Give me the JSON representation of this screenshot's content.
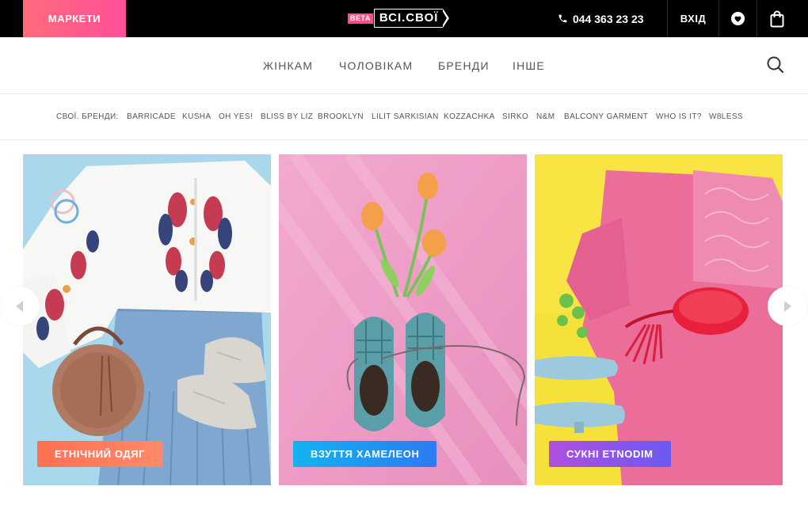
{
  "header": {
    "markets_label": "МАРКЕТИ",
    "logo_beta": "BETA",
    "logo_name": "ВСІ.СВОЇ",
    "phone": "044 363 23 23",
    "login_label": "ВХІД",
    "icons": [
      "phone-icon",
      "heart-icon",
      "shopping-bag-icon"
    ]
  },
  "nav": {
    "items": [
      "ЖІНКАМ",
      "ЧОЛОВІКАМ",
      "БРЕНДИ",
      "ІНШЕ"
    ],
    "search_icon": "search-icon"
  },
  "brands": {
    "label": "СВОЇ. БРЕНДИ:",
    "items": [
      "BARRICADE",
      "KUSHA",
      "OH YES!",
      "BLISS BY LIZ",
      "BROOKLYN",
      "LILIT SARKISIAN",
      "KOZZACHKA",
      "SIRKO",
      "N&M",
      "BALCONY GARMENT",
      "WHO IS IT?",
      "W8LESS"
    ]
  },
  "carousel": {
    "prev_icon": "chevron-left-icon",
    "next_icon": "chevron-right-icon",
    "cards": [
      {
        "button": "ЕТНІЧНИЙ ОДЯГ",
        "button_colors": [
          "#ff6f52",
          "#ff8a6a"
        ],
        "bg_color": "#a9d8ec"
      },
      {
        "button": "ВЗУТТЯ ХАМЕЛЕОН",
        "button_colors": [
          "#12b3f0",
          "#2d7bf0"
        ],
        "bg_color": "#ee9fc6"
      },
      {
        "button": "СУКНІ ETNODIM",
        "button_colors": [
          "#b04fe0",
          "#6b5af0"
        ],
        "bg_color": "#f6e03a"
      }
    ]
  },
  "colors": {
    "topbar": "#000000",
    "markets_gradient": [
      "#ff6b7a",
      "#ff4f9a"
    ],
    "beta": "#ff4f8b"
  }
}
